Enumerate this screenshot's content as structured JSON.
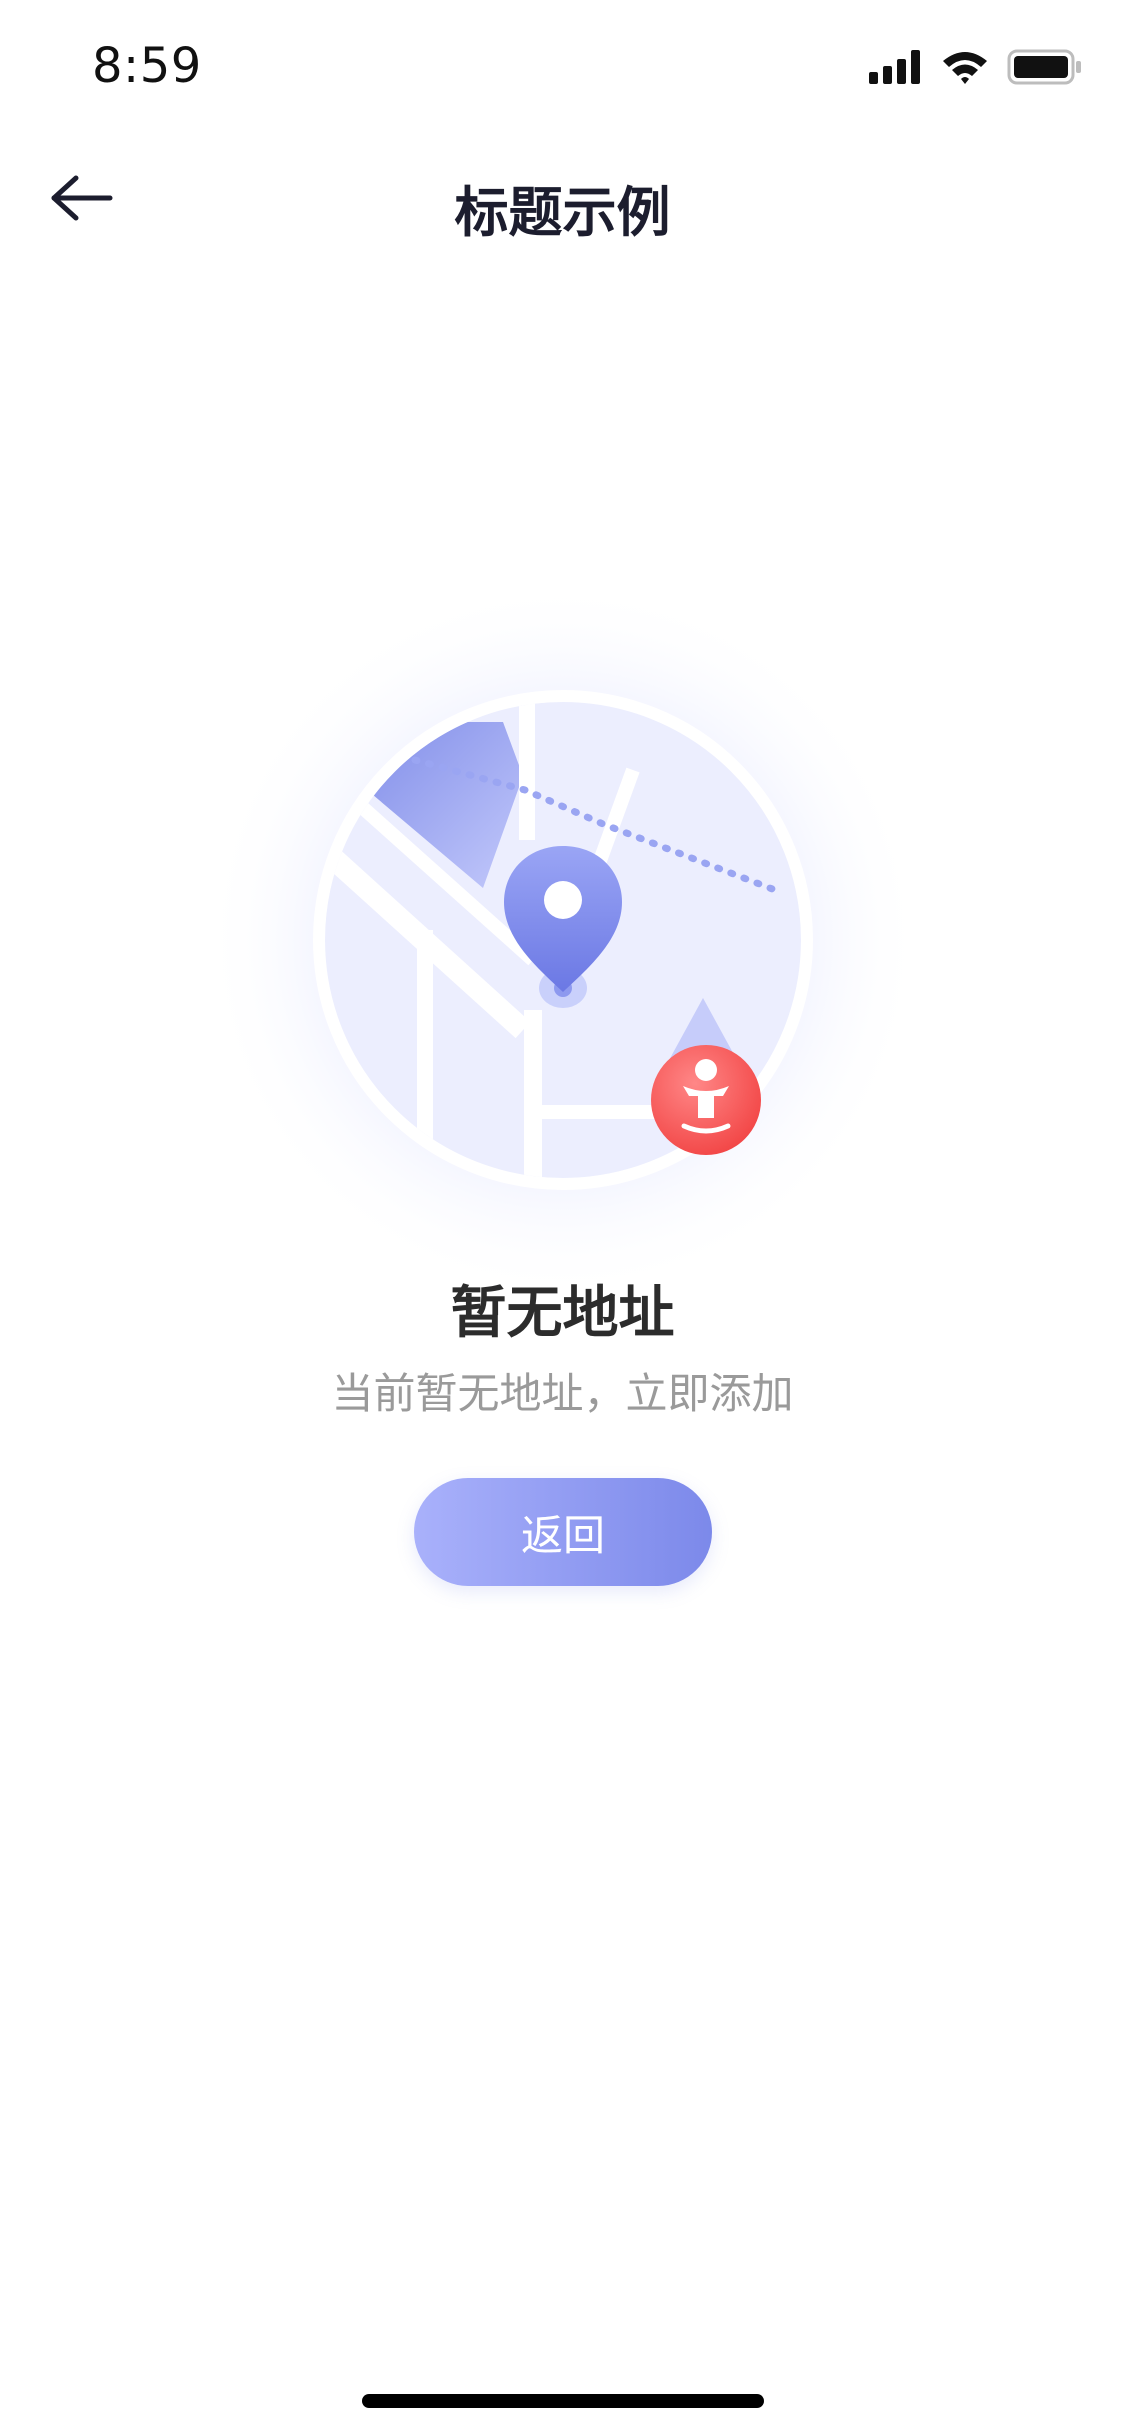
{
  "status_bar": {
    "time": "8:59",
    "icons": [
      "signal-icon",
      "wifi-icon",
      "battery-icon"
    ]
  },
  "nav": {
    "title": "标题示例",
    "back_icon": "back-arrow-icon"
  },
  "empty_state": {
    "title": "暂无地址",
    "description": "当前暂无地址，立即添加",
    "button_label": "返回",
    "illustration_icons": [
      "map-icon",
      "location-pin-icon",
      "person-badge-icon"
    ]
  },
  "colors": {
    "accent_start": "#a9b1fb",
    "accent_end": "#7c89ea",
    "badge": "#ff4f4f",
    "title_text": "#1c1d2e",
    "desc_text": "#9a9a9a"
  }
}
